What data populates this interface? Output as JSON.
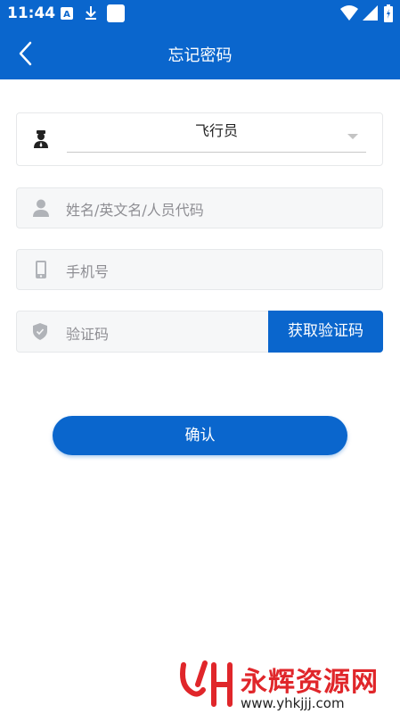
{
  "status_bar": {
    "time": "11:44",
    "icons": [
      "a-icon",
      "download-icon",
      "square-icon",
      "wifi-icon",
      "signal-icon",
      "battery-icon"
    ]
  },
  "header": {
    "title": "忘记密码",
    "back_icon": "chevron-left-icon"
  },
  "form": {
    "role": {
      "value": "飞行员",
      "icon": "pilot-icon"
    },
    "name": {
      "placeholder": "姓名/英文名/人员代码",
      "icon": "person-icon"
    },
    "phone": {
      "placeholder": "手机号",
      "icon": "phone-icon"
    },
    "code": {
      "placeholder": "验证码",
      "icon": "shield-icon",
      "get_code_label": "获取验证码"
    }
  },
  "confirm_label": "确认",
  "watermark": {
    "brand": "永辉资源网",
    "url": "www.yhkjjj.com"
  },
  "colors": {
    "primary": "#0a66cd",
    "field_bg": "#f6f7f8",
    "placeholder": "#8e8e93",
    "watermark": "#e0262a"
  }
}
